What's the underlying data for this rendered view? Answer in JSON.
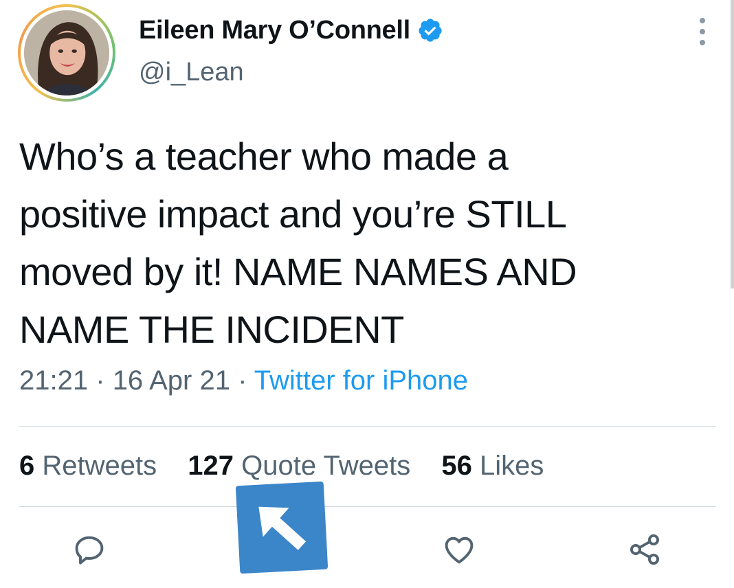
{
  "author": {
    "display_name": "Eileen Mary O’Connell",
    "handle": "@i_Lean",
    "verified": true
  },
  "tweet": {
    "lines": [
      "Who’s a teacher who made a",
      "positive impact and you’re STILL",
      "moved by it! NAME NAMES AND",
      "NAME THE INCIDENT"
    ],
    "time": "21:21",
    "separator": "·",
    "date": "16 Apr 21",
    "source": "Twitter for iPhone"
  },
  "stats": {
    "retweets_count": "6",
    "retweets_label": "Retweets",
    "quotes_count": "127",
    "quotes_label": "Quote Tweets",
    "likes_count": "56",
    "likes_label": "Likes"
  },
  "icons": {
    "more": "more-vertical-icon",
    "reply": "reply-icon",
    "like": "heart-icon",
    "share": "share-icon",
    "overlay": "arrow-up-left-icon"
  },
  "colors": {
    "text": "#0f1419",
    "secondary": "#536471",
    "link": "#1d9bf0",
    "verified": "#1d9bf0",
    "overlay": "#3b86c8"
  }
}
